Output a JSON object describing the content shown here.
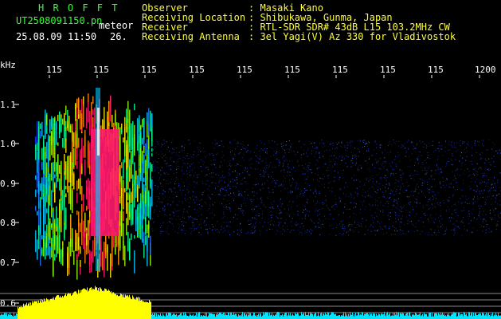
{
  "header": {
    "app_title": "H R O F F T",
    "filename": "UT2508091150.pn",
    "label_meteor": "meteor",
    "datetime": "25.08.09 11:50",
    "number": "26.",
    "fields": [
      {
        "label": "Observer",
        "value": ": Masaki Kano"
      },
      {
        "label": "Receiving Location",
        "value": ": Shibukawa, Gunma, Japan"
      },
      {
        "label": "Receiver",
        "value": ": RTL-SDR SDR# 43dB L15 103.2MHz CW"
      },
      {
        "label": "Receiving Antenna",
        "value": ": 3el Yagi(V) Az 330 for Vladivostok"
      }
    ]
  },
  "axis": {
    "y_unit": "kHz",
    "y_ticks": [
      "1.1",
      "1.0",
      "0.9",
      "0.8",
      "0.7",
      "0.6"
    ],
    "x_ticks": [
      "115",
      "115",
      "115",
      "115",
      "115",
      "115",
      "115",
      "115",
      "115",
      "1200"
    ]
  },
  "colors": {
    "background": "#000000",
    "header_green": "#33ff33",
    "header_yellow": "#ffff33",
    "meteor_core": "#ff1a6e",
    "noise_blue": "#1a3cff",
    "power_yellow": "#ffff00",
    "power_cyan": "#00e5ff"
  }
}
